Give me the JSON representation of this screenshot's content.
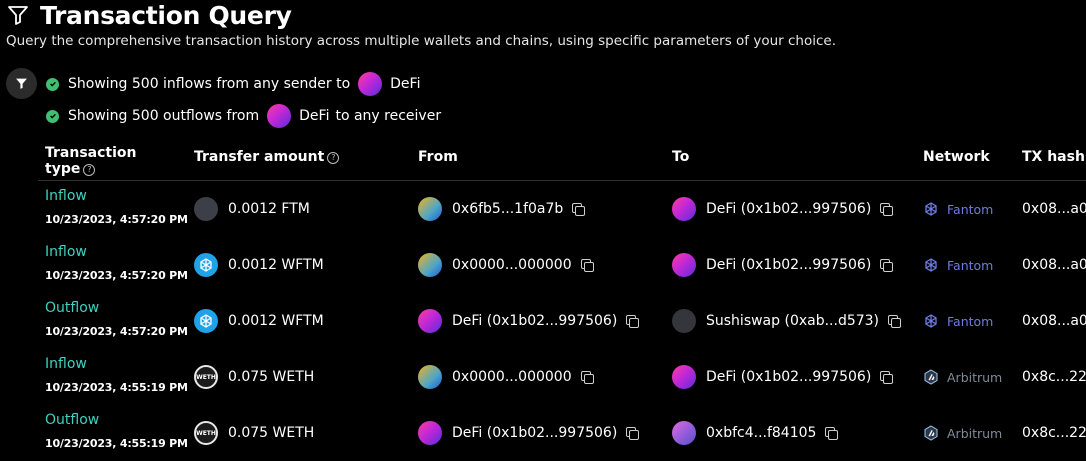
{
  "header": {
    "title": "Transaction Query",
    "subtitle": "Query the comprehensive transaction history across multiple wallets and chains, using specific parameters of your choice."
  },
  "filters": {
    "inflows": {
      "prefix": "Showing 500 inflows from any sender to",
      "entity": "DeFi",
      "suffix": ""
    },
    "outflows": {
      "prefix": "Showing 500 outflows from",
      "entity": "DeFi",
      "suffix": "to any receiver"
    }
  },
  "table": {
    "headers": {
      "type_line1": "Transaction",
      "type_line2": "type",
      "amount": "Transfer amount",
      "from": "From",
      "to": "To",
      "network": "Network",
      "txhash": "TX hash"
    },
    "rows": [
      {
        "type": "Inflow",
        "date": "10/23/2023, 4:57:20 PM",
        "amount": "0.0012 FTM",
        "from": "0x6fb5...1f0a7b",
        "to": "DeFi (0x1b02...997506)",
        "network": "Fantom",
        "tx": "0x08...a0"
      },
      {
        "type": "Inflow",
        "date": "10/23/2023, 4:57:20 PM",
        "amount": "0.0012 WFTM",
        "from": "0x0000...000000",
        "to": "DeFi (0x1b02...997506)",
        "network": "Fantom",
        "tx": "0x08...a0"
      },
      {
        "type": "Outflow",
        "date": "10/23/2023, 4:57:20 PM",
        "amount": "0.0012 WFTM",
        "from": "DeFi (0x1b02...997506)",
        "to": "Sushiswap (0xab...d573)",
        "network": "Fantom",
        "tx": "0x08...a0"
      },
      {
        "type": "Inflow",
        "date": "10/23/2023, 4:55:19 PM",
        "amount": "0.075 WETH",
        "from": "0x0000...000000",
        "to": "DeFi (0x1b02...997506)",
        "network": "Arbitrum",
        "tx": "0x8c...22"
      },
      {
        "type": "Outflow",
        "date": "10/23/2023, 4:55:19 PM",
        "amount": "0.075 WETH",
        "from": "DeFi (0x1b02...997506)",
        "to": "0xbfc4...f84105",
        "network": "Arbitrum",
        "tx": "0x8c...22"
      }
    ]
  },
  "icons": {
    "weth_label": "WETH"
  },
  "colors": {
    "background": "#000000",
    "type_text": "#3fd0c0",
    "check": "#3fbf72",
    "fantom": "#6b7de0",
    "arbitrum": "#7f8a98"
  }
}
